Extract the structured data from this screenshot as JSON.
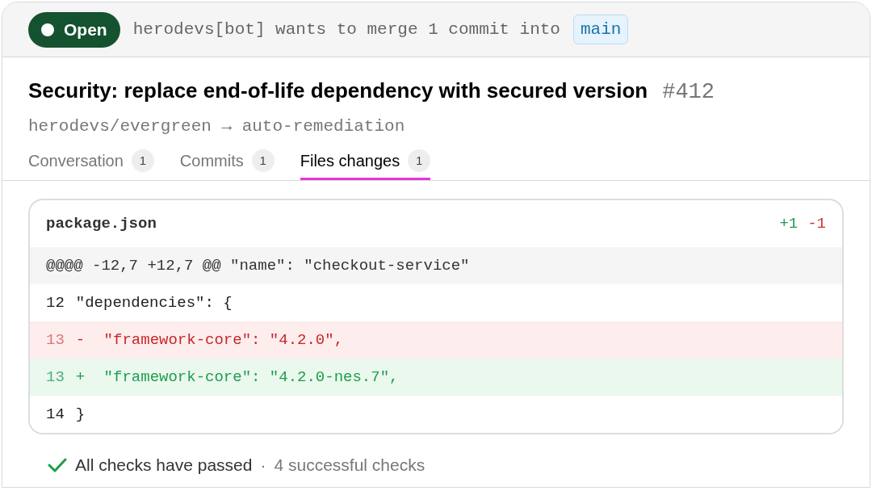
{
  "status": {
    "label": "Open",
    "kind": "open"
  },
  "merge_message": "herodevs[bot] wants to merge 1 commit into",
  "target_branch": "main",
  "title": "Security: replace end-of-life dependency with secured version",
  "number": "#412",
  "branches": "herodevs/evergreen → auto-remediation",
  "tabs": [
    {
      "label": "Conversation",
      "count": "1",
      "selected": false
    },
    {
      "label": "Commits",
      "count": "1",
      "selected": false
    },
    {
      "label": "Files changes",
      "count": "1",
      "selected": true
    }
  ],
  "diff": {
    "file": "package.json",
    "additions": "+1",
    "deletions": "-1",
    "lines": [
      {
        "kind": "hunk",
        "code": "@@@@ -12,7 +12,7 @@ \"name\": \"checkout-service\""
      },
      {
        "kind": "context",
        "number": "12",
        "code": "\"dependencies\": {"
      },
      {
        "kind": "removed",
        "number": "13",
        "sign": "-",
        "code": " \"framework-core\": \"4.2.0\","
      },
      {
        "kind": "added",
        "number": "13",
        "sign": "+",
        "code": " \"framework-core\": \"4.2.0-nes.7\","
      },
      {
        "kind": "context",
        "number": "14",
        "code": "}"
      }
    ]
  },
  "checks": {
    "passed": true,
    "summary": "All checks have passed",
    "separator": "·",
    "detail": "4 successful checks"
  }
}
